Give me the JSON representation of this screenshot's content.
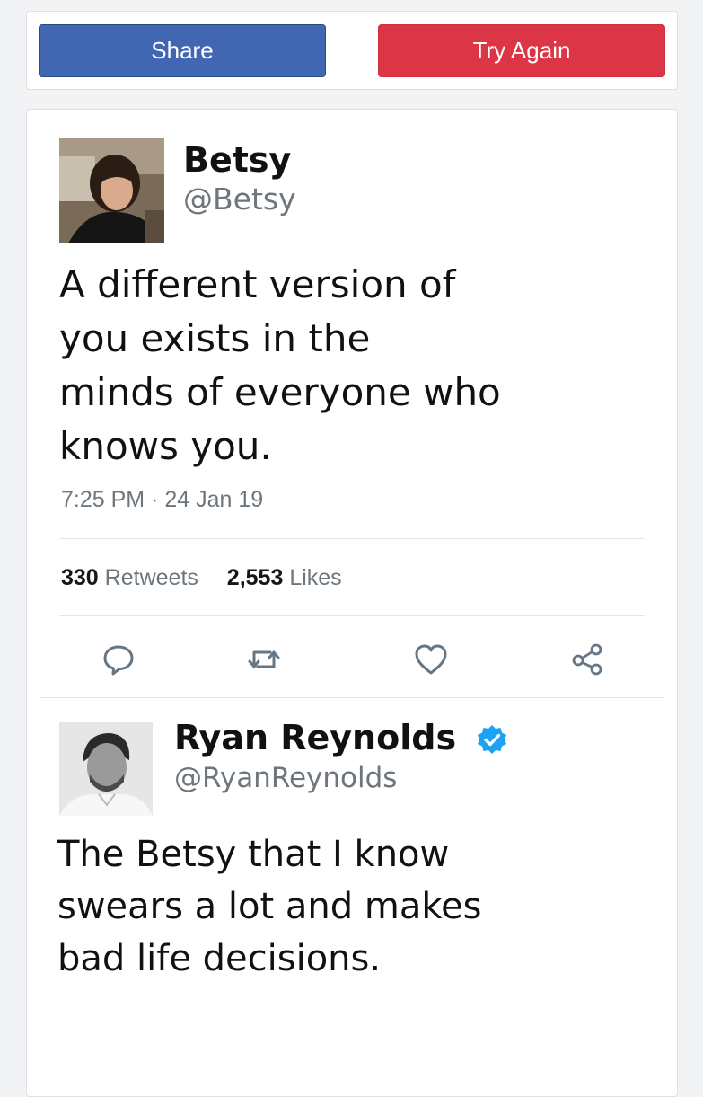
{
  "toolbar": {
    "share_label": "Share",
    "try_again_label": "Try Again"
  },
  "tweet": {
    "author_name": "Betsy",
    "author_handle": "@Betsy",
    "text_lines": [
      "A different version of",
      "you exists in the",
      "minds of everyone who",
      "knows you."
    ],
    "time": "7:25 PM",
    "date": "24 Jan 19",
    "retweets_count": "330",
    "retweets_label": "Retweets",
    "likes_count": "2,553",
    "likes_label": "Likes"
  },
  "reply": {
    "author_name": "Ryan Reynolds",
    "author_handle": "@RyanReynolds",
    "verified": true,
    "text_lines": [
      "The Betsy that I know",
      "swears a lot and makes",
      "bad life decisions."
    ]
  },
  "actions": [
    "reply-icon",
    "retweet-icon",
    "like-icon",
    "share-icon"
  ],
  "colors": {
    "share_button": "#4267b2",
    "try_again_button": "#dc3545",
    "verified_badge": "#1da1f2",
    "meta_text": "#6e767d"
  }
}
